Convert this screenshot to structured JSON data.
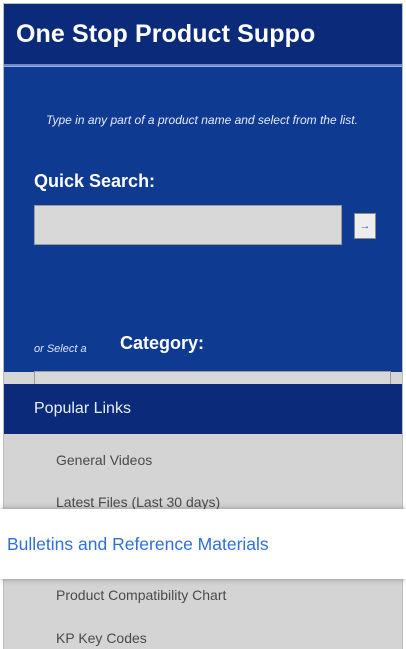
{
  "header": {
    "title": "One Stop Product Suppo"
  },
  "search_panel": {
    "hint": "Type in any part of a product name and select from the list.",
    "quick_search_label": "Quick Search:",
    "quick_search_value": "",
    "go_button_icon": "arrow-right-icon",
    "go_button_glyph": "→",
    "or_select_text": "or Select a",
    "category_label": "Category:",
    "category_value": ""
  },
  "popular_links": {
    "title": "Popular Links",
    "items": [
      {
        "label": "General Videos"
      },
      {
        "label": "Latest Files (Last 30 days)"
      },
      {
        "label": "Bulletins and Reference Materials",
        "highlighted": true
      },
      {
        "label": "Product Compatibility Chart"
      },
      {
        "label": "KP Key Codes"
      }
    ]
  },
  "colors": {
    "header_bg": "#0b2b7a",
    "panel_bg": "#0e3a92",
    "links_bg": "#d4d4d4",
    "highlight_link": "#2f6fd6"
  }
}
